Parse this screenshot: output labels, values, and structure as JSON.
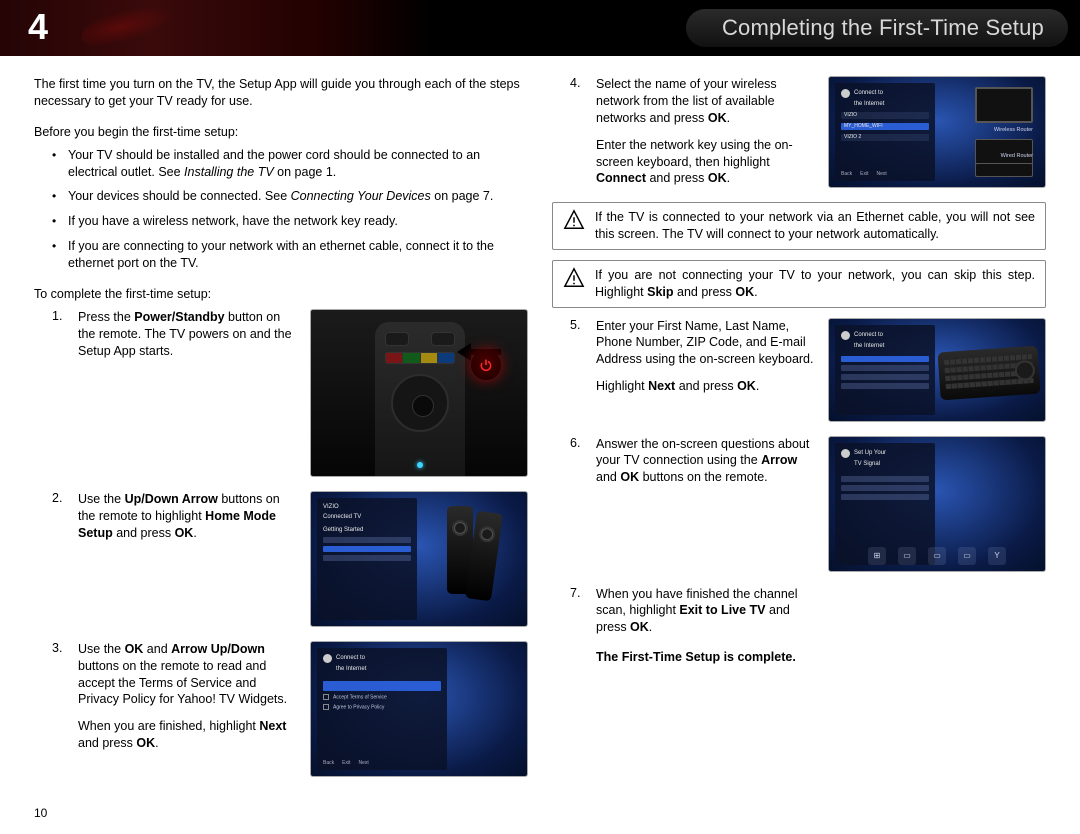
{
  "header": {
    "chapter_num": "4",
    "title": "Completing the First-Time Setup"
  },
  "page_number": "10",
  "left": {
    "intro": "The first time you turn on the TV, the Setup App will guide you through each of the steps necessary to get your TV ready for use.",
    "before_lead": "Before you begin the first-time setup:",
    "bullets": {
      "b1_pre": "Your TV should be installed and the power cord should be connected to an electrical outlet. See ",
      "b1_em": "Installing the TV",
      "b1_post": " on page 1.",
      "b2_pre": "Your devices should be connected. See ",
      "b2_em": "Connecting Your Devices",
      "b2_post": " on page 7.",
      "b3": "If you have a wireless network, have the network key ready.",
      "b4": "If you are connecting to your network with an ethernet cable, connect it to the ethernet port on the TV."
    },
    "complete_lead": "To complete the first-time setup:",
    "steps": {
      "s1": {
        "n": "1.",
        "t_pre": "Press the ",
        "t_b1": "Power/Standby",
        "t_post": " button on the remote. The TV powers on and the Setup App starts."
      },
      "s2": {
        "n": "2.",
        "t_pre": "Use the ",
        "t_b1": "Up/Down Arrow",
        "t_mid1": " buttons on the remote to highlight ",
        "t_b2": "Home Mode Setup",
        "t_mid2": " and press ",
        "t_b3": "OK",
        "t_post": "."
      },
      "s3": {
        "n": "3.",
        "t_pre": "Use the ",
        "t_b1": "OK",
        "t_mid1": " and ",
        "t_b2": "Arrow Up/Down",
        "t_post1": " buttons on the remote to read and accept the Terms of Service and Privacy Policy for Yahoo! TV Widgets.",
        "p2_pre": "When you are finished, highlight ",
        "p2_b": "Next",
        "p2_mid": " and press ",
        "p2_b2": "OK",
        "p2_post": "."
      }
    },
    "fig2": {
      "brand": "VIZIO",
      "subtitle": "Connected TV",
      "heading": "Getting Started"
    },
    "fig3": {
      "title1": "Connect to",
      "title2": "the Internet"
    }
  },
  "right": {
    "steps": {
      "s4": {
        "n": "4.",
        "p1_pre": "Select the name of your wireless network from the list of available networks and press ",
        "p1_b": "OK",
        "p1_post": ".",
        "p2_pre": "Enter the network key using the on-screen keyboard, then highlight ",
        "p2_b": "Connect",
        "p2_mid": " and press ",
        "p2_b2": "OK",
        "p2_post": "."
      },
      "s5": {
        "n": "5.",
        "p1": "Enter your First Name, Last Name, Phone Number, ZIP Code, and E-mail Address using the on-screen keyboard.",
        "p2_pre": "Highlight ",
        "p2_b": "Next",
        "p2_mid": " and press ",
        "p2_b2": "OK",
        "p2_post": "."
      },
      "s6": {
        "n": "6.",
        "p1_pre": "Answer the on-screen questions about your TV connection using the ",
        "p1_b1": "Arrow",
        "p1_mid": " and ",
        "p1_b2": "OK",
        "p1_post": " buttons on the remote."
      },
      "s7": {
        "n": "7.",
        "p1_pre": "When you have finished the channel scan, highlight ",
        "p1_b": "Exit to Live TV",
        "p1_mid": " and press ",
        "p1_b2": "OK",
        "p1_post": "."
      }
    },
    "note1": "If the TV is connected to your network via an Ethernet cable, you will not see this screen. The TV will connect to your network automatically.",
    "note2_pre": "If you are not connecting your TV to your network, you can skip this step. Highlight ",
    "note2_b": "Skip",
    "note2_mid": " and press ",
    "note2_b2": "OK",
    "note2_post": ".",
    "fig4": {
      "title1": "Connect to",
      "title2": "the Internet",
      "net_sel": "MY_HOME_WIFI",
      "net_a": "VIZIO",
      "net_b": "VIZIO 2",
      "lblA": "Wireless Router",
      "lblB": "Wired Router"
    },
    "fig5": {
      "title1": "Connect to",
      "title2": "the Internet"
    },
    "fig6": {
      "title1": "Set Up Your",
      "title2": "TV Signal"
    },
    "complete": "The First-Time Setup is complete."
  }
}
